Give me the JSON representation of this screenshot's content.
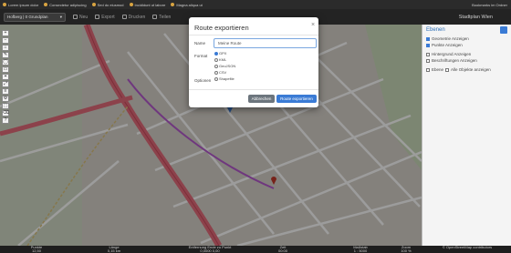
{
  "bookmarks": {
    "items": [
      "Lorem ipsum dolor",
      "Consectetur adipiscing",
      "Sed do eiusmod",
      "Incididunt ut labore",
      "Magna aliqua ut"
    ],
    "right": "Bookmarks im Ordner"
  },
  "toolbar": {
    "plan_value": "Hofberg | 0 Grundplan",
    "items": [
      "Neu",
      "Export",
      "Drucken",
      "Teilen"
    ],
    "right_label": "Stadtplan Wien"
  },
  "map_controls": [
    "+",
    "−",
    "⌂",
    "✎",
    "◯",
    "▭",
    "⌖",
    "⤢",
    "≡",
    "⚙",
    "⬚",
    "⌫",
    "?"
  ],
  "right_panel": {
    "title": "Ebenen",
    "rows": [
      {
        "label": "Geometrie Anzeigen",
        "checked": true
      },
      {
        "label": "Punkte Anzeigen",
        "checked": true
      },
      {
        "label": "Hintergrund Anzeigen",
        "checked": false
      },
      {
        "label": "Beschriftungen Anzeigen",
        "checked": false
      }
    ],
    "filter_a": "Ebene",
    "filter_b": "Alle Objekte anzeigen"
  },
  "modal": {
    "title": "Route exportieren",
    "close": "×",
    "name_label": "Name",
    "name_value": "Meine Route",
    "format_label": "Format",
    "formats": [
      "GPX",
      "KML",
      "GeoJSON",
      "CSV",
      "Shapefile"
    ],
    "selected_format": "GPX",
    "options_label": "Optionen",
    "cancel_label": "Abbrechen",
    "export_label": "Route exportieren"
  },
  "statusbar": {
    "cols": [
      {
        "top": "Punkte",
        "bottom": "12,50"
      },
      {
        "top": "Länge",
        "bottom": "0,15 km"
      },
      {
        "top": "Entfernung Ende zu Punkt",
        "bottom": "0,0000 0,00"
      },
      {
        "top": "Zeit",
        "bottom": "00:00"
      },
      {
        "top": "Maßstab",
        "bottom": "1 : 5000"
      },
      {
        "top": "Zoom",
        "bottom": "100 %"
      }
    ],
    "right_note": "© OpenStreetMap contributors"
  }
}
